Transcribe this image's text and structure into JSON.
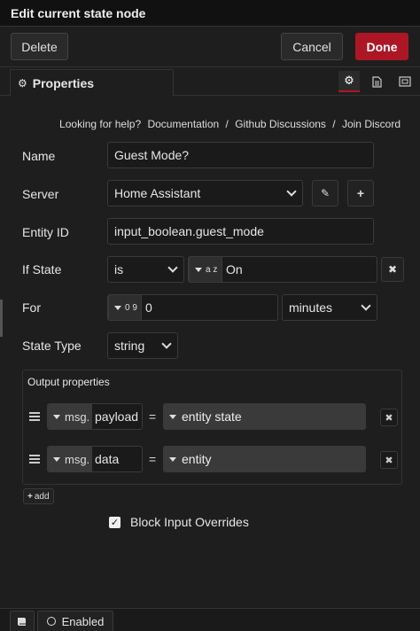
{
  "dialog": {
    "title": "Edit current state node"
  },
  "toolbar": {
    "delete_label": "Delete",
    "cancel_label": "Cancel",
    "done_label": "Done"
  },
  "tabs": {
    "properties_label": "Properties"
  },
  "help": {
    "prefix": "Looking for help?",
    "links": [
      "Documentation",
      "Github Discussions",
      "Join Discord"
    ],
    "separator": "/"
  },
  "form": {
    "name": {
      "label": "Name",
      "value": "Guest Mode?"
    },
    "server": {
      "label": "Server",
      "value": "Home Assistant"
    },
    "entity_id": {
      "label": "Entity ID",
      "value": "input_boolean.guest_mode"
    },
    "if_state": {
      "label": "If State",
      "operator": "is",
      "type_label": "a z",
      "value": "On"
    },
    "for": {
      "label": "For",
      "type_label": "0 9",
      "value": "0",
      "unit": "minutes"
    },
    "state_type": {
      "label": "State Type",
      "value": "string"
    }
  },
  "output_properties": {
    "legend": "Output properties",
    "rows": [
      {
        "prefix": "msg.",
        "property": "payload",
        "equals": "=",
        "value": "entity state"
      },
      {
        "prefix": "msg.",
        "property": "data",
        "equals": "=",
        "value": "entity"
      }
    ],
    "add_label": "add"
  },
  "block_input_overrides": {
    "label": "Block Input Overrides",
    "checked": true
  },
  "footer": {
    "enabled_label": "Enabled"
  },
  "colors": {
    "accent": "#ad1625",
    "background": "#1e1e1e"
  },
  "icons": [
    "gear-icon",
    "document-icon",
    "frame-icon",
    "pencil-icon",
    "plus-icon",
    "x-icon",
    "drag-handle-icon",
    "book-icon",
    "circle-icon"
  ]
}
